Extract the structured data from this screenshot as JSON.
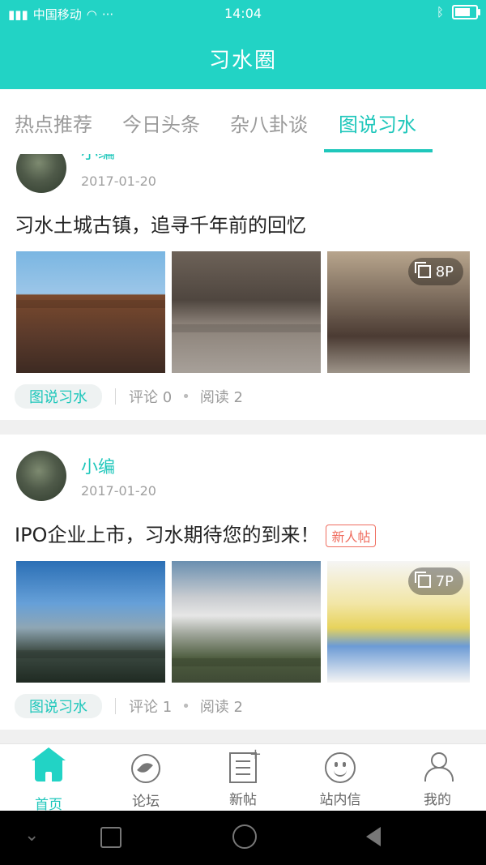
{
  "status_bar": {
    "carrier": "中国移动",
    "time": "14:04",
    "more": "···"
  },
  "header": {
    "title": "习水圈"
  },
  "tabs": [
    {
      "label": "热点推荐"
    },
    {
      "label": "今日头条"
    },
    {
      "label": "杂八卦谈"
    },
    {
      "label": "图说习水",
      "active": true
    }
  ],
  "posts": [
    {
      "author": "小编",
      "date": "2017-01-20",
      "title": "习水土城古镇，追寻千年前的回忆",
      "images": [
        "ancient-gate",
        "stone-steps-street",
        "old-town-lane"
      ],
      "photo_count": "8P",
      "category": "图说习水",
      "comments": "评论 0",
      "reads": "阅读 2"
    },
    {
      "author": "小编",
      "date": "2017-01-20",
      "title": "IPO企业上市，习水期待您的到来！",
      "badge": "新人帖",
      "images": [
        "city-skyline",
        "cloud-city",
        "baton-handoff"
      ],
      "photo_count": "7P",
      "category": "图说习水",
      "comments": "评论 1",
      "reads": "阅读 2"
    }
  ],
  "bottom_nav": [
    {
      "label": "首页",
      "icon": "home-icon",
      "active": true
    },
    {
      "label": "论坛",
      "icon": "compass-icon"
    },
    {
      "label": "新帖",
      "icon": "new-post-icon"
    },
    {
      "label": "站内信",
      "icon": "message-icon"
    },
    {
      "label": "我的",
      "icon": "user-icon"
    }
  ],
  "colors": {
    "accent": "#22d3c5",
    "badge_red": "#ef6d5f"
  }
}
